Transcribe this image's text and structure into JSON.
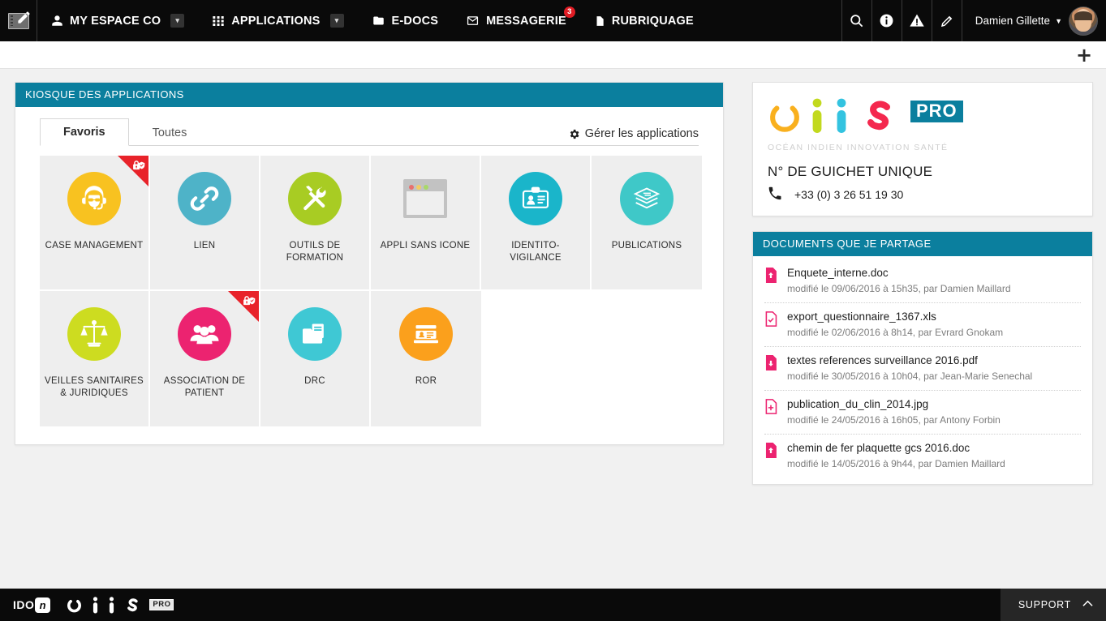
{
  "topnav": {
    "logo_icon": "tablet-pen-icon",
    "items": [
      {
        "label": "MY ESPACE CO",
        "icon": "user-icon",
        "has_caret": true,
        "badge": null
      },
      {
        "label": "APPLICATIONS",
        "icon": "grid-icon",
        "has_caret": true,
        "badge": null
      },
      {
        "label": "E-DOCS",
        "icon": "folder-icon",
        "has_caret": false,
        "badge": null
      },
      {
        "label": "MESSAGERIE",
        "icon": "envelope-icon",
        "has_caret": false,
        "badge": "3"
      },
      {
        "label": "RUBRIQUAGE",
        "icon": "file-icon",
        "has_caret": false,
        "badge": null
      }
    ],
    "tools": [
      {
        "name": "search-icon"
      },
      {
        "name": "info-icon"
      },
      {
        "name": "warning-icon"
      },
      {
        "name": "edit-pencil-icon"
      }
    ],
    "user": {
      "name": "Damien Gillette",
      "caret": "▼",
      "avatar": "user-avatar"
    }
  },
  "subbar": {
    "add_label": "+"
  },
  "kiosque": {
    "title": "KIOSQUE DES APPLICATIONS",
    "tabs": [
      {
        "label": "Favoris",
        "active": true
      },
      {
        "label": "Toutes",
        "active": false
      }
    ],
    "manage_label": "Gérer les applications",
    "manage_icon": "gear-icon",
    "apps": [
      {
        "label": "CASE MANAGEMENT",
        "icon": "headset-agent-icon",
        "color": "#f8c220",
        "favorite": true
      },
      {
        "label": "LIEN",
        "icon": "chain-link-icon",
        "color": "#4eb3c8",
        "favorite": false
      },
      {
        "label": "OUTILS DE FORMATION",
        "icon": "tools-wrench-icon",
        "color": "#a8cc23",
        "favorite": false
      },
      {
        "label": "APPLI SANS ICONE",
        "icon": "placeholder-window-icon",
        "color": "#c2c2c2",
        "favorite": false
      },
      {
        "label": "IDENTITO-VIGILANCE",
        "icon": "id-badge-icon",
        "color": "#1ab5ca",
        "favorite": false
      },
      {
        "label": "PUBLICATIONS",
        "icon": "stacked-papers-icon",
        "color": "#3fc8c8",
        "favorite": false
      },
      {
        "label": "VEILLES SANITAIRES & JURIDIQUES",
        "icon": "scales-justice-icon",
        "color": "#cddc20",
        "favorite": false
      },
      {
        "label": "ASSOCIATION DE PATIENT",
        "icon": "group-people-icon",
        "color": "#ec2370",
        "favorite": true
      },
      {
        "label": "DRC",
        "icon": "folder-document-icon",
        "color": "#3fc8d4",
        "favorite": false
      },
      {
        "label": "ROR",
        "icon": "id-card-icon",
        "color": "#fba01c",
        "favorite": false
      }
    ]
  },
  "brand": {
    "logo_letters": [
      "o",
      "i",
      "i",
      "s"
    ],
    "pro_label": "PRO",
    "tagline": "OCÉAN INDIEN INNOVATION SANTÉ",
    "guichet_title": "N° DE GUICHET UNIQUE",
    "phone_icon": "phone-icon",
    "phone": "+33 (0) 3 26 51 19 30"
  },
  "documents": {
    "title": "DOCUMENTS QUE JE PARTAGE",
    "items": [
      {
        "name": "Enquete_interne.doc",
        "meta": "modifié le 09/06/2016 à 15h35, par Damien Maillard",
        "icon": "doc-upload-icon"
      },
      {
        "name": "export_questionnaire_1367.xls",
        "meta": "modifié le 02/06/2016 à 8h14, par Evrard Gnokam",
        "icon": "doc-check-icon"
      },
      {
        "name": "textes references surveillance 2016.pdf",
        "meta": "modifié le 30/05/2016 à 10h04, par Jean-Marie Senechal",
        "icon": "doc-download-icon"
      },
      {
        "name": "publication_du_clin_2014.jpg",
        "meta": "modifié le 24/05/2016 à 16h05, par Antony Forbin",
        "icon": "doc-add-icon"
      },
      {
        "name": "chemin de fer plaquette gcs 2016.doc",
        "meta": "modifié le 14/05/2016 à 9h44, par Damien Maillard",
        "icon": "doc-upload-icon"
      }
    ]
  },
  "footer": {
    "ido_label": "IDO",
    "ido_mark": "n",
    "pro_label": "PRO",
    "support_label": "SUPPORT",
    "support_caret": "︿"
  },
  "colors": {
    "panel_header": "#0b7f9e",
    "topbar": "#0a0a0a",
    "badge_red": "#e01c24",
    "fav_red": "#e8232a",
    "doc_pink": "#ec2370"
  }
}
